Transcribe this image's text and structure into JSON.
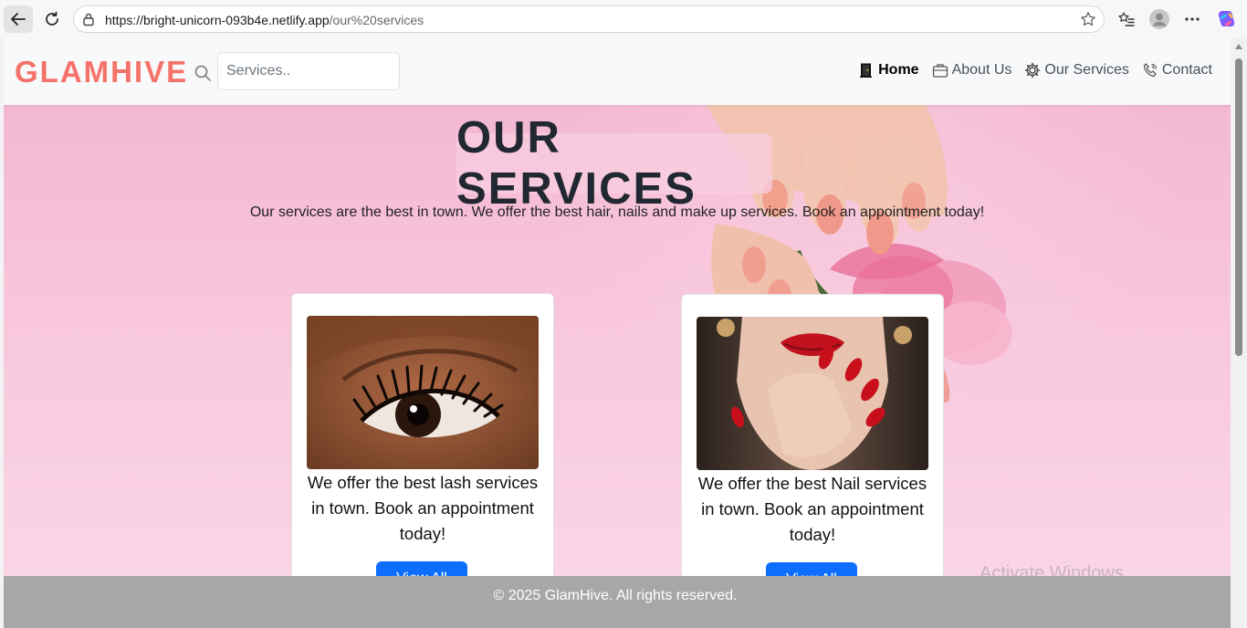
{
  "browser": {
    "url_host": "https://bright-unicorn-093b4e.netlify.app",
    "url_path": "/our%20services"
  },
  "navbar": {
    "brand": "GLAMHIVE",
    "search_placeholder": "Services..",
    "links": [
      {
        "label": "Home",
        "active": true
      },
      {
        "label": "About Us",
        "active": false
      },
      {
        "label": "Our Services",
        "active": false
      },
      {
        "label": "Contact",
        "active": false
      }
    ]
  },
  "hero": {
    "title": "OUR SERVICES",
    "subtitle": "Our services are the best in town. We offer the best hair, nails and make up services. Book an appointment today!"
  },
  "cards": [
    {
      "text": "We offer the best lash services in town. Book an appointment today!",
      "button": "View All"
    },
    {
      "text": "We offer the best Nail services in town. Book an appointment today!",
      "button": "View All"
    }
  ],
  "watermark": "Activate Windows",
  "footer": {
    "text": "© 2025 GlamHive. All rights reserved."
  },
  "colors": {
    "brand": "#f4736a",
    "button": "#0d6efd",
    "footer": "#a7a7a7",
    "hero_pink": "#f8c6dc"
  }
}
